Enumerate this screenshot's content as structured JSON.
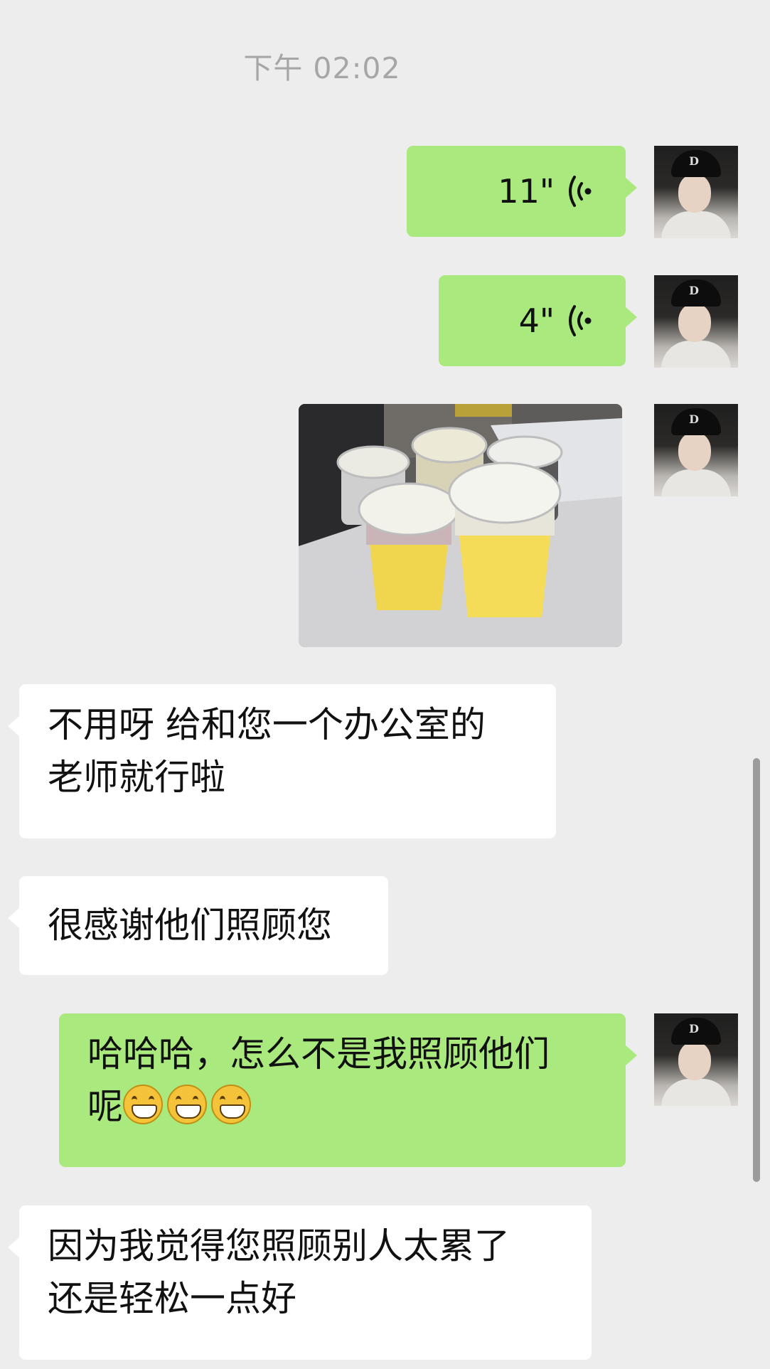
{
  "chat": {
    "timestamp": "下午 02:02",
    "messages": [
      {
        "side": "right",
        "type": "voice",
        "duration": "11\""
      },
      {
        "side": "right",
        "type": "voice",
        "duration": "4\""
      },
      {
        "side": "right",
        "type": "image"
      },
      {
        "side": "left",
        "type": "text",
        "lines": [
          "不用呀 给和您一个办公室的",
          "老师就行啦"
        ]
      },
      {
        "side": "left",
        "type": "text",
        "lines": [
          "很感谢他们照顾您"
        ]
      },
      {
        "side": "right",
        "type": "text",
        "lines": [
          "哈哈哈，怎么不是我照顾他们",
          "呢"
        ],
        "emoji": [
          "grin-emoji",
          "grin-emoji",
          "grin-emoji"
        ]
      },
      {
        "side": "left",
        "type": "text",
        "lines": [
          "因为我觉得您照顾别人太累了",
          "还是轻松一点好"
        ]
      }
    ]
  },
  "colors": {
    "background": "#ededed",
    "sent_bubble": "#a9e97e",
    "received_bubble": "#ffffff",
    "timestamp_text": "#a6a6a6"
  },
  "icons": {
    "voice": "voice-wave-icon",
    "avatar": "user-avatar"
  }
}
